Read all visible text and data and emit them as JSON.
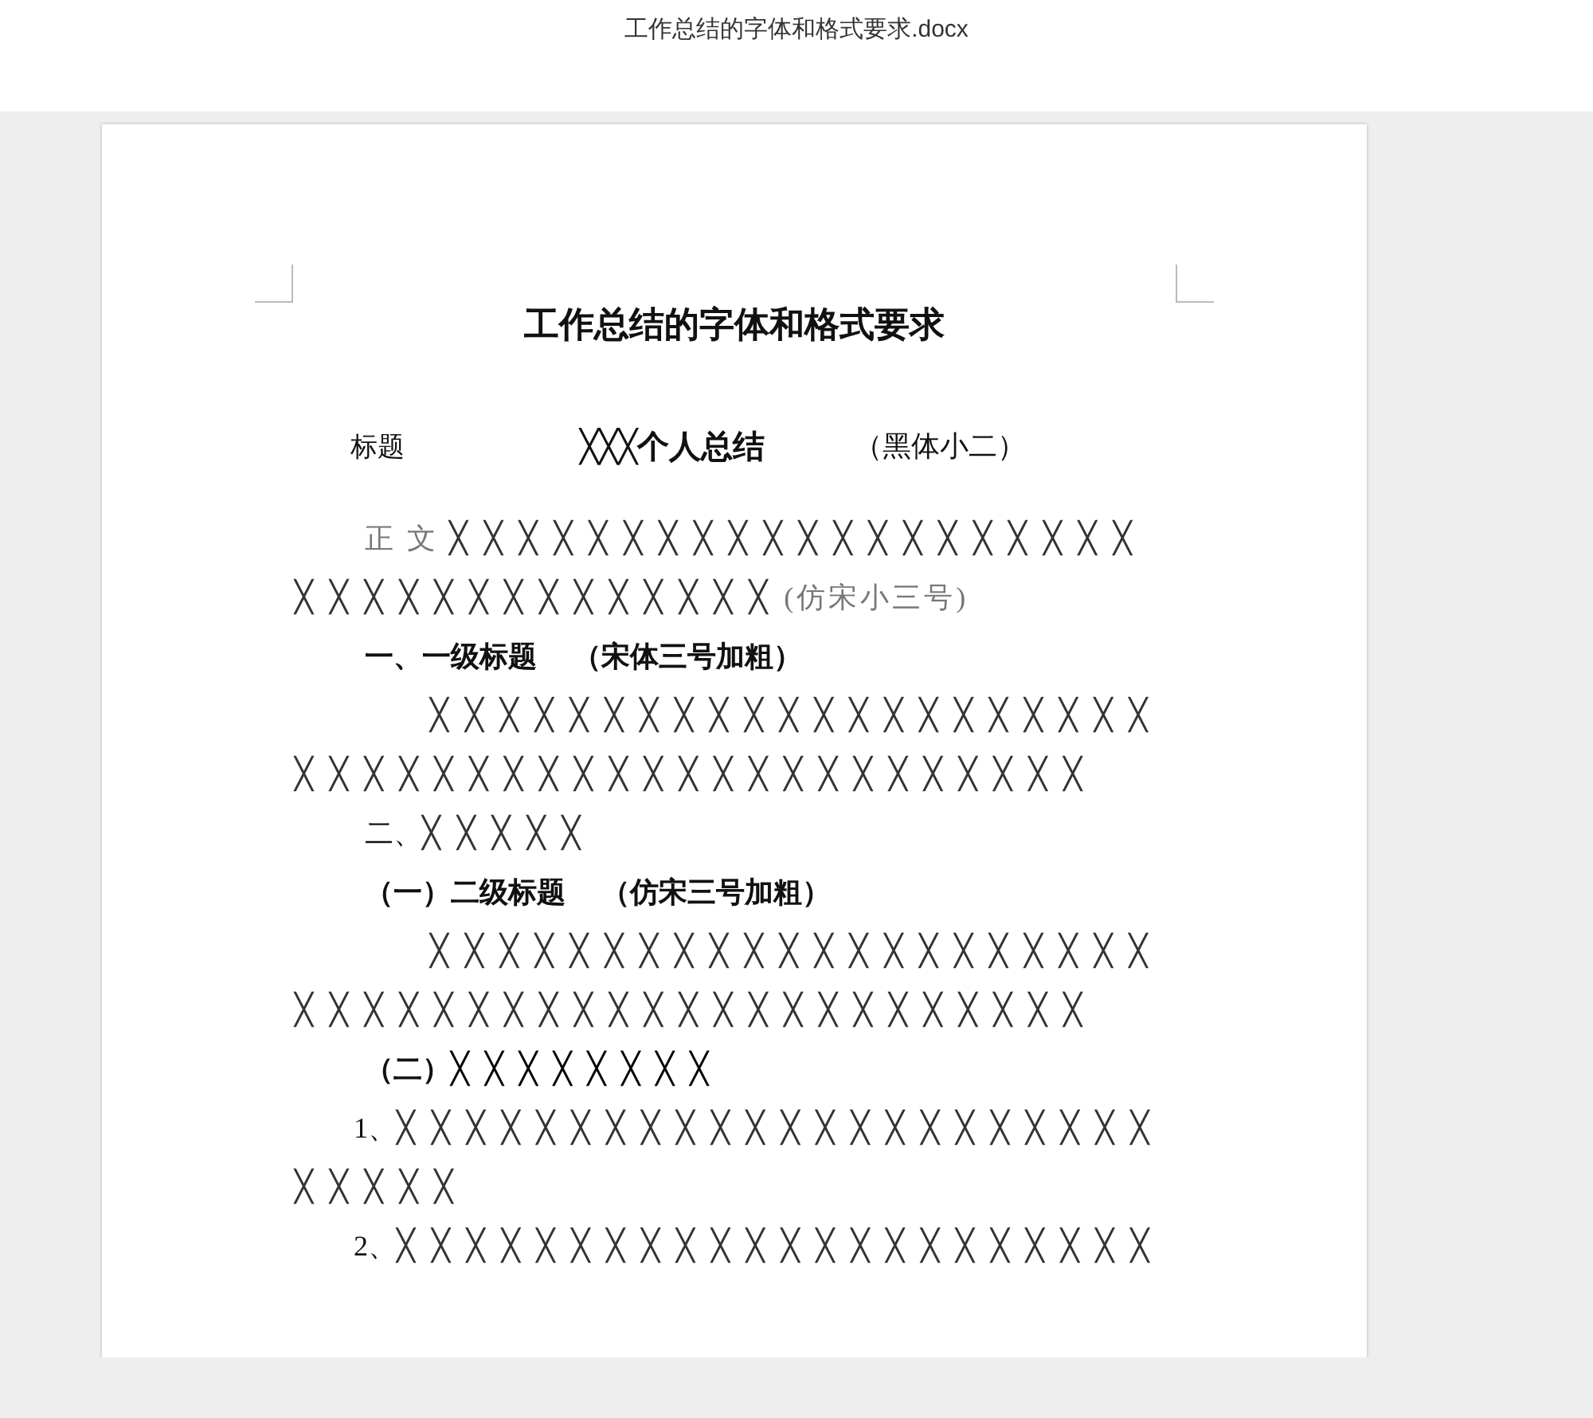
{
  "window": {
    "title": "工作总结的字体和格式要求.docx"
  },
  "document": {
    "heading": "工作总结的字体和格式要求",
    "title_line": {
      "label": "标题",
      "sample": "╳╳╳个人总结",
      "note": "（黑体小二）"
    },
    "paragraphs": [
      {
        "kind": "body",
        "segments": [
          {
            "text": "正 文  ",
            "kind": "note"
          },
          {
            "text": "╳╳╳╳╳╳╳╳╳╳╳╳╳╳╳╳╳╳╳╳╳╳╳╳╳╳╳╳╳╳╳╳╳╳",
            "kind": "cross"
          },
          {
            "text": "(仿宋小三号)",
            "kind": "note"
          }
        ]
      },
      {
        "kind": "heading1",
        "segments": [
          {
            "text": "一、一级标题　 （宋体三号加粗）",
            "kind": "bold"
          }
        ]
      },
      {
        "kind": "indented",
        "segments": [
          {
            "text": "╳╳╳╳╳╳╳╳╳╳╳╳╳╳╳╳╳╳╳╳╳╳╳╳╳╳╳╳╳╳╳╳╳╳╳╳╳╳╳╳╳╳╳╳",
            "kind": "cross"
          }
        ]
      },
      {
        "kind": "body",
        "segments": [
          {
            "text": "二、",
            "kind": "plain"
          },
          {
            "text": "╳╳╳╳╳",
            "kind": "cross"
          }
        ]
      },
      {
        "kind": "heading2",
        "segments": [
          {
            "text": "（一）二级标题　 （仿宋三号加粗）",
            "kind": "bold"
          }
        ]
      },
      {
        "kind": "indented",
        "segments": [
          {
            "text": "╳╳╳╳╳╳╳╳╳╳╳╳╳╳╳╳╳╳╳╳╳╳╳╳╳╳╳╳╳╳╳╳╳╳╳╳╳╳╳╳╳╳╳╳",
            "kind": "cross"
          }
        ]
      },
      {
        "kind": "heading2",
        "segments": [
          {
            "text": "（二）",
            "kind": "bold"
          },
          {
            "text": "╳╳╳╳╳╳╳╳",
            "kind": "boldcross"
          }
        ]
      },
      {
        "kind": "item",
        "segments": [
          {
            "text": "1、",
            "kind": "plain"
          },
          {
            "text": "╳╳╳╳╳╳╳╳╳╳╳╳╳╳╳╳╳╳╳╳╳╳╳╳╳╳╳",
            "kind": "cross"
          }
        ]
      },
      {
        "kind": "item",
        "segments": [
          {
            "text": "2、",
            "kind": "plain"
          },
          {
            "text": "╳╳╳╳╳╳╳╳╳╳╳╳╳╳╳╳╳╳╳╳╳╳",
            "kind": "cross"
          }
        ]
      }
    ]
  }
}
